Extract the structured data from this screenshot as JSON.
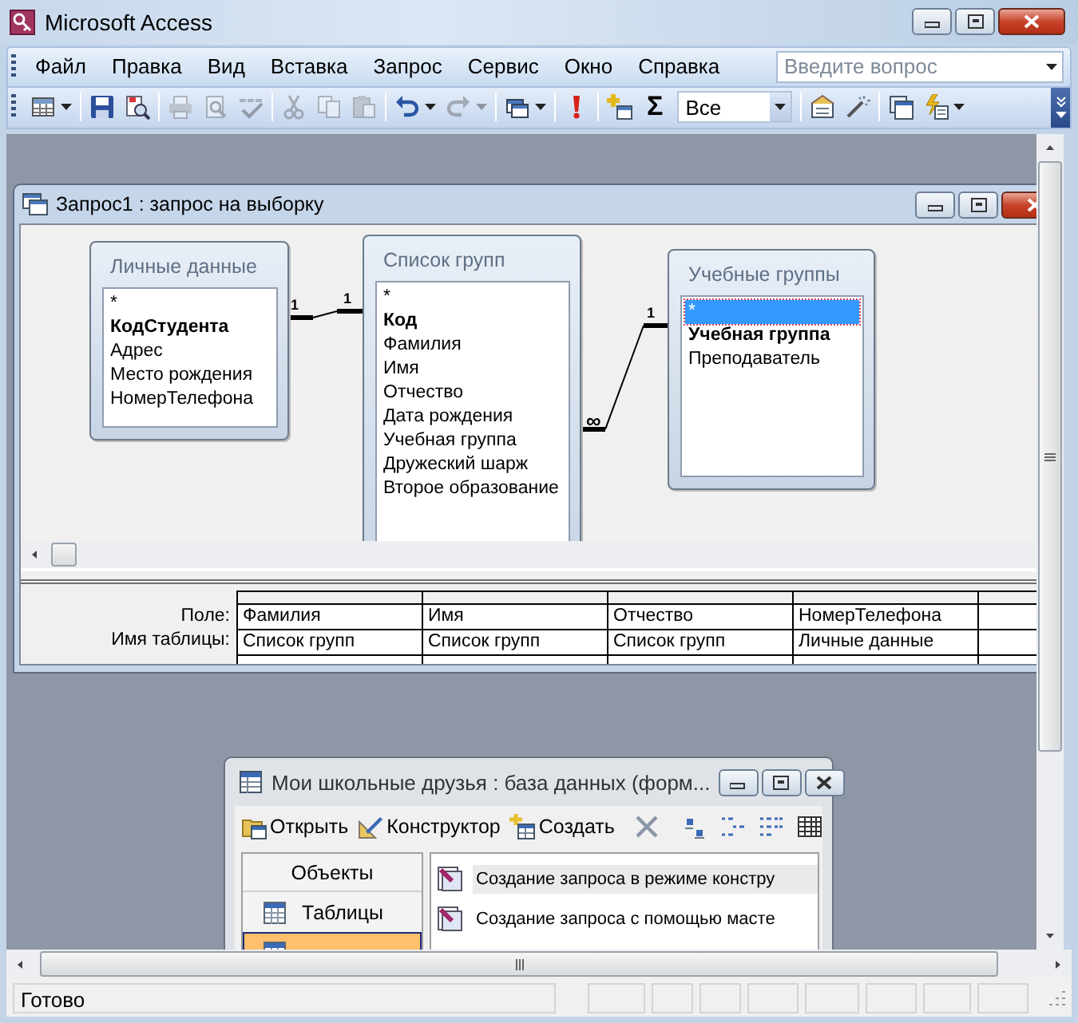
{
  "window": {
    "title": "Microsoft Access"
  },
  "menu": [
    {
      "label": "Файл"
    },
    {
      "label": "Правка"
    },
    {
      "label": "Вид"
    },
    {
      "label": "Вставка"
    },
    {
      "label": "Запрос"
    },
    {
      "label": "Сервис"
    },
    {
      "label": "Окно"
    },
    {
      "label": "Справка"
    }
  ],
  "help_search": {
    "placeholder": "Введите вопрос"
  },
  "toolbar": [
    {
      "kind": "view",
      "disabled": false,
      "dropdown": true
    },
    {
      "kind": "separator"
    },
    {
      "kind": "save",
      "disabled": false,
      "dropdown": false
    },
    {
      "kind": "search_file",
      "disabled": false,
      "dropdown": false
    },
    {
      "kind": "separator"
    },
    {
      "kind": "print",
      "disabled": true,
      "dropdown": false
    },
    {
      "kind": "preview",
      "disabled": true,
      "dropdown": false
    },
    {
      "kind": "spelling",
      "disabled": true,
      "dropdown": false
    },
    {
      "kind": "separator"
    },
    {
      "kind": "cut",
      "disabled": true,
      "dropdown": false
    },
    {
      "kind": "copy",
      "disabled": true,
      "dropdown": false
    },
    {
      "kind": "paste",
      "disabled": true,
      "dropdown": false
    },
    {
      "kind": "separator"
    },
    {
      "kind": "undo",
      "disabled": false,
      "dropdown": true
    },
    {
      "kind": "redo",
      "disabled": true,
      "dropdown": true
    },
    {
      "kind": "separator"
    },
    {
      "kind": "query_type",
      "disabled": false,
      "dropdown": true
    },
    {
      "kind": "separator"
    },
    {
      "kind": "run",
      "disabled": false,
      "dropdown": false
    },
    {
      "kind": "separator"
    },
    {
      "kind": "show_table",
      "disabled": false,
      "dropdown": false
    },
    {
      "kind": "totals",
      "label": "Σ",
      "disabled": false,
      "dropdown": false
    },
    {
      "kind": "combo",
      "value": "Все"
    },
    {
      "kind": "separator"
    },
    {
      "kind": "properties",
      "disabled": false,
      "dropdown": false
    },
    {
      "kind": "builder",
      "disabled": false,
      "dropdown": false
    },
    {
      "kind": "separator"
    },
    {
      "kind": "db_window",
      "disabled": false,
      "dropdown": false
    },
    {
      "kind": "new_object",
      "disabled": false,
      "dropdown": true
    }
  ],
  "query_window": {
    "title": "Запрос1 : запрос на выборку",
    "tables": [
      {
        "title": "Личные данные",
        "fields": [
          {
            "name": "*",
            "key": false,
            "selected": false
          },
          {
            "name": "КодСтудента",
            "key": true,
            "selected": false
          },
          {
            "name": "Адрес",
            "key": false,
            "selected": false
          },
          {
            "name": "Место рождения",
            "key": false,
            "selected": false
          },
          {
            "name": "НомерТелефона",
            "key": false,
            "selected": false
          }
        ]
      },
      {
        "title": "Список групп",
        "fields": [
          {
            "name": "*",
            "key": false,
            "selected": false
          },
          {
            "name": "Код",
            "key": true,
            "selected": false
          },
          {
            "name": "Фамилия",
            "key": false,
            "selected": false
          },
          {
            "name": "Имя",
            "key": false,
            "selected": false
          },
          {
            "name": "Отчество",
            "key": false,
            "selected": false
          },
          {
            "name": "Дата рождения",
            "key": false,
            "selected": false
          },
          {
            "name": "Учебная группа",
            "key": false,
            "selected": false
          },
          {
            "name": "Дружеский шарж",
            "key": false,
            "selected": false
          },
          {
            "name": "Второе образование",
            "key": false,
            "selected": false
          }
        ]
      },
      {
        "title": "Учебные группы",
        "fields": [
          {
            "name": "*",
            "key": false,
            "selected": true
          },
          {
            "name": "Учебная группа",
            "key": true,
            "selected": false
          },
          {
            "name": "Преподаватель",
            "key": false,
            "selected": false
          }
        ]
      }
    ],
    "relationships": [
      {
        "from_end": "1",
        "to_end": "1"
      },
      {
        "from_end": "∞",
        "to_end": "1"
      }
    ],
    "grid": {
      "row_labels": [
        "Поле:",
        "Имя таблицы:"
      ],
      "columns": [
        {
          "field": "Фамилия",
          "table": "Список групп"
        },
        {
          "field": "Имя",
          "table": "Список групп"
        },
        {
          "field": "Отчество",
          "table": "Список групп"
        },
        {
          "field": "НомерТелефона",
          "table": "Личные данные"
        }
      ]
    }
  },
  "database_window": {
    "title": "Мои школьные друзья : база данных (форм...",
    "toolbar": [
      {
        "kind": "open",
        "label": "Открыть"
      },
      {
        "kind": "design",
        "label": "Конструктор"
      },
      {
        "kind": "create",
        "label": "Создать"
      },
      {
        "kind": "separator"
      },
      {
        "kind": "delete"
      },
      {
        "kind": "separator"
      },
      {
        "kind": "large_icons"
      },
      {
        "kind": "small_icons"
      },
      {
        "kind": "list"
      },
      {
        "kind": "details"
      }
    ],
    "objects_header": "Объекты",
    "objects": [
      {
        "label": "Таблицы",
        "selected": false
      },
      {
        "selected": true
      }
    ],
    "items": [
      {
        "label": "Создание запроса в режиме констру",
        "selected": true
      },
      {
        "label": "Создание запроса с помощью масте",
        "selected": false
      }
    ]
  },
  "status_bar": {
    "text": "Готово"
  }
}
